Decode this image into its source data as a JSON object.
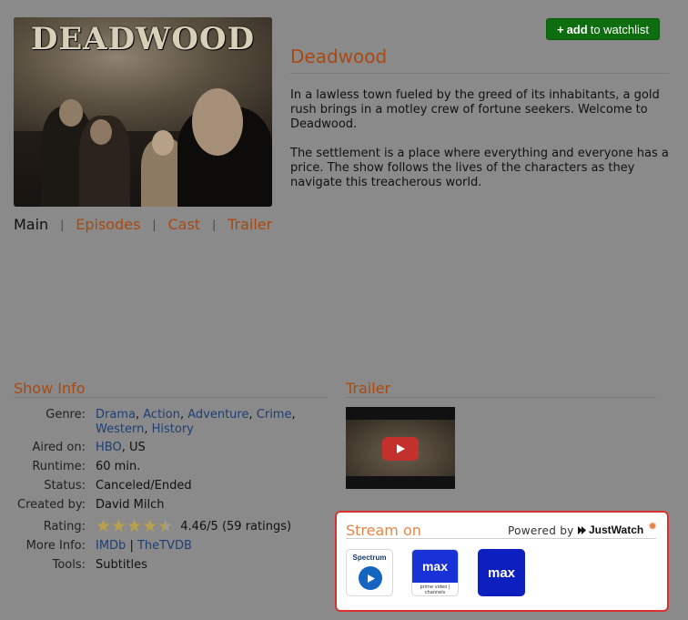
{
  "poster": {
    "logo_text": "DEADWOOD"
  },
  "watchlist": {
    "plus": "+",
    "bold": "add",
    "rest": "to watchlist"
  },
  "show": {
    "title": "Deadwood",
    "description": [
      "In a lawless town fueled by the greed of its inhabitants, a gold rush brings in a motley crew of fortune seekers. Welcome to Deadwood.",
      "The settlement is a place where everything and everyone has a price. The show follows the lives of the characters as they navigate this treacherous world."
    ]
  },
  "subnav": {
    "items": [
      "Main",
      "Episodes",
      "Cast",
      "Trailer"
    ],
    "separator": "|"
  },
  "show_info": {
    "heading": "Show Info",
    "genre_label": "Genre:",
    "genres": [
      "Drama",
      "Action",
      "Adventure",
      "Crime",
      "Western",
      "History"
    ],
    "genre_sep": ",",
    "aired_label": "Aired on:",
    "aired_link": "HBO",
    "aired_rest": ", US",
    "runtime_label": "Runtime:",
    "runtime": "60 min.",
    "status_label": "Status:",
    "status": "Canceled/Ended",
    "created_label": "Created by:",
    "created_by": "David Milch",
    "rating_label": "Rating:",
    "rating_value": 4.46,
    "rating_text": "4.46/5 (59 ratings)",
    "more_label": "More Info:",
    "more_links": [
      "IMDb",
      "TheTVDB"
    ],
    "more_sep": "|",
    "tools_label": "Tools:",
    "tools_link": "Subtitles"
  },
  "trailer": {
    "heading": "Trailer",
    "play_icon": "youtube-play-icon"
  },
  "stream": {
    "heading": "Stream on",
    "powered_by": "Powered by",
    "brand": "JustWatch",
    "gear_icon": "gear-icon",
    "providers": [
      {
        "name": "Spectrum",
        "logo_text": "Spectrum"
      },
      {
        "name": "Max (Prime Video Channels)",
        "logo_text": "max",
        "sub_text": "prime video | channels"
      },
      {
        "name": "Max",
        "logo_text": "max"
      }
    ]
  },
  "colors": {
    "page_bg": "#8a8a8a",
    "accent": "#a84a12",
    "link": "#1f3f73",
    "watchlist_btn": "#0e6d0e",
    "stream_border": "#d9322e",
    "stream_heading": "#e6874a",
    "star_filled": "#b8a14a"
  }
}
